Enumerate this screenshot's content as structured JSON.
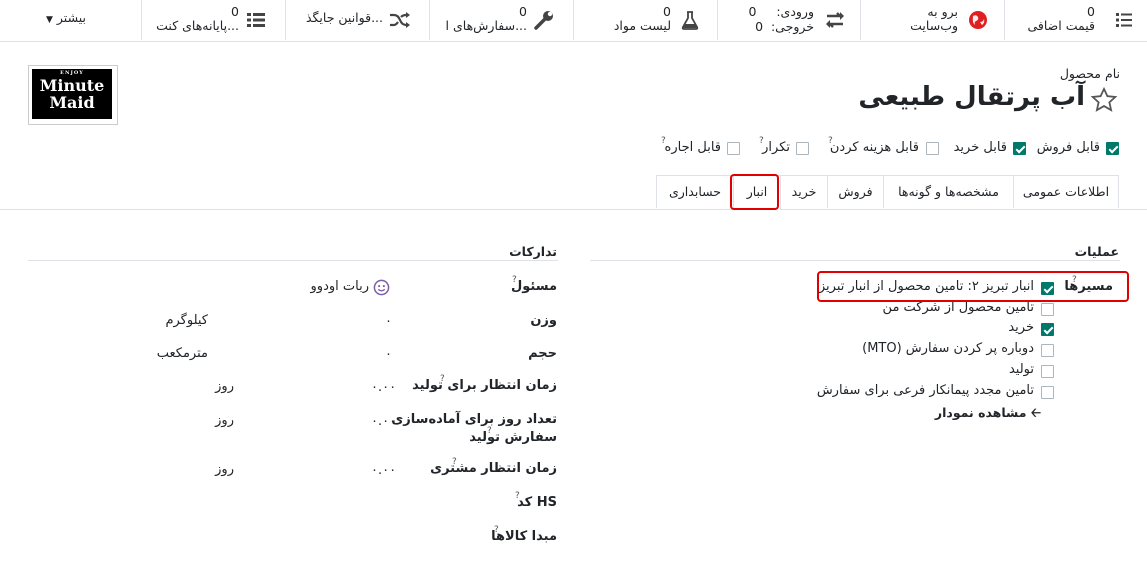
{
  "smart_buttons": {
    "extra_price": {
      "count": "0",
      "label": "قیمت اضافی"
    },
    "website": {
      "line1": "برو به",
      "line2": "وب‌سایت"
    },
    "in_out": {
      "in_label": "ورودی:",
      "in_value": "0",
      "out_label": "خروجی:",
      "out_value": "0"
    },
    "bom": {
      "count": "0",
      "label": "لیست مواد"
    },
    "orders": {
      "count": "0",
      "label": "سفارش‌های ا..."
    },
    "putaway": {
      "label": "قوانین جایگذ..."
    },
    "kits": {
      "count": "0",
      "label": "پایانه‌های کنت..."
    },
    "more": {
      "label": "بیشتر"
    }
  },
  "product": {
    "name_label": "نام محصول",
    "name": "آب پرتقال طبیعی",
    "logo_line1": "ENJOY",
    "logo_line2": "Minute",
    "logo_line3": "Maid"
  },
  "flags": [
    {
      "label": "قابل فروش",
      "checked": true
    },
    {
      "label": "قابل خرید",
      "checked": true
    },
    {
      "label": "قابل هزینه کردن",
      "checked": false
    },
    {
      "label": "تکرار",
      "checked": false
    },
    {
      "label": "قابل اجاره",
      "checked": false
    }
  ],
  "tabs": [
    "اطلاعات عمومی",
    "مشخصه‌ها و گونه‌ها",
    "فروش",
    "خرید",
    "انبار",
    "حسابداری"
  ],
  "active_tab": "انبار",
  "operations": {
    "title": "عملیات",
    "routes_label": "مسیرها",
    "routes": [
      {
        "label": "انبار تبریز ۲: تامین محصول از انبار تبریز",
        "checked": true
      },
      {
        "label": "تامین محصول از شرکت من",
        "checked": false
      },
      {
        "label": "خرید",
        "checked": true
      },
      {
        "label": "دوباره پر کردن سفارش (MTO)",
        "checked": false
      },
      {
        "label": "تولید",
        "checked": false
      },
      {
        "label": "تامین مجدد پیمانکار فرعی برای سفارش",
        "checked": false
      }
    ],
    "diagram_link": "مشاهده نمودار"
  },
  "logistics": {
    "title": "تدارکات",
    "responsible_label": "مسئول",
    "responsible_value": "ربات اودوو",
    "weight_label": "وزن",
    "weight_value": "۰",
    "weight_unit": "کیلوگرم",
    "volume_label": "حجم",
    "volume_value": "۰",
    "volume_unit": "مترمکعب",
    "mfg_lead_label": "زمان انتظار برای تولید",
    "mfg_lead_value": "۰.۰۰",
    "mfg_lead_unit": "روز",
    "prep_days_label1": "تعداد روز برای آماده‌سازی",
    "prep_days_label2": "سفارش تولید",
    "prep_days_value": "۰.۰۰",
    "prep_days_unit": "روز",
    "customer_lead_label": "زمان انتظار مشتری",
    "customer_lead_value": "۰.۰۰",
    "customer_lead_unit": "روز",
    "hs_code_label": "کد HS",
    "origin_label": "مبدا کالاها"
  }
}
